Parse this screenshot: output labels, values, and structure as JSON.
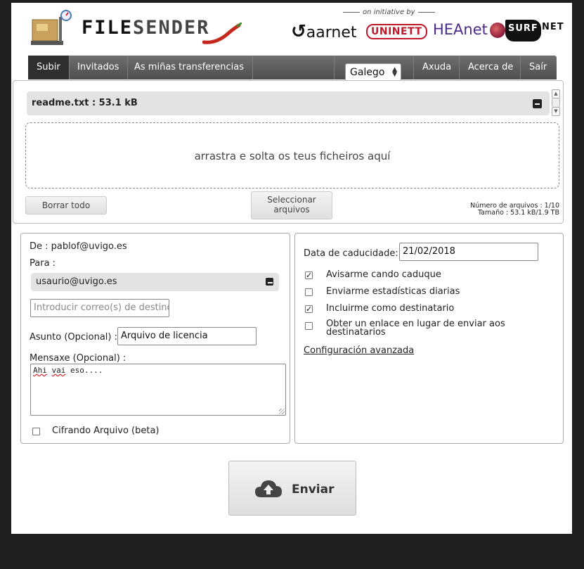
{
  "header": {
    "logo_part1": "FILE",
    "logo_part2": "SENDER",
    "initiative": "on initiative by",
    "partners": {
      "aarnet": "aarnet",
      "uninett": "UNINETT",
      "heanet": "HEAnet",
      "surf": "SURF",
      "net": "NET"
    }
  },
  "nav": {
    "upload": "Subir",
    "guests": "Invitados",
    "my_transfers": "As miñas transferencias",
    "language": "Galego",
    "help": "Axuda",
    "about": "Acerca de",
    "logout": "Saír"
  },
  "upload": {
    "file_entry": "readme.txt : 53.1 kB",
    "dropzone_text": "arrastra e solta os teus ficheiros aquí",
    "clear_all": "Borrar todo",
    "select_files_line1": "Seleccionar",
    "select_files_line2": "arquivos",
    "file_count": "Número de arquivos : 1/10",
    "size": "Tamaño : 53.1 kB/1.9 TB"
  },
  "form": {
    "from": "De : pablof@uvigo.es",
    "to_label": "Para :",
    "recipient": "usaurio@uvigo.es",
    "email_placeholder": "Introducir correo(s) de destino",
    "subject_label": "Asunto (Opcional) :",
    "subject_value": "Arquivo de licencia",
    "message_label": "Mensaxe (Opcional) :",
    "message_word1": "Ahi",
    "message_word2": "vai",
    "message_rest": " eso....",
    "encrypt_label": "Cifrando Arquivo (beta)"
  },
  "options": {
    "expiry_label": "Data de caducidade:",
    "expiry_value": "21/02/2018",
    "opt1": "Avisarme cando caduque",
    "opt2": "Enviarme estadísticas diarias",
    "opt3": "Incluirme como destinatario",
    "opt4_line1": "Obter un enlace en lugar de enviar aos",
    "opt4_line2": "destinatarios",
    "advanced": "Configuración avanzada",
    "checked": [
      true,
      false,
      true,
      false
    ]
  },
  "send_label": "Enviar"
}
